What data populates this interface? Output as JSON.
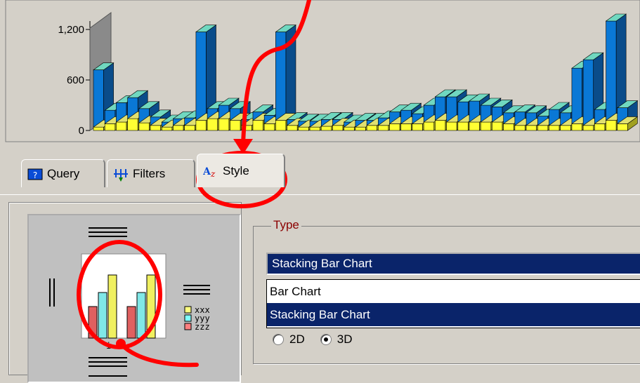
{
  "chart_data": {
    "type": "bar",
    "yticks": [
      "1,200",
      "600",
      "0"
    ],
    "ylim": [
      0,
      1300
    ],
    "stacked": true,
    "three_d": true,
    "series": [
      {
        "color": "#0a78d6",
        "values": [
          680,
          160,
          230,
          250,
          170,
          100,
          60,
          80,
          90,
          1050,
          120,
          160,
          140,
          70,
          100,
          100,
          1050,
          70,
          70,
          70,
          80,
          70,
          60,
          80,
          60,
          90,
          140,
          160,
          120,
          200,
          280,
          300,
          240,
          250,
          200,
          180,
          130,
          160,
          150,
          110,
          190,
          150,
          660,
          780,
          170,
          1180,
          190
        ]
      },
      {
        "color": "#ffff33",
        "values": [
          40,
          80,
          100,
          140,
          90,
          60,
          40,
          60,
          60,
          120,
          140,
          140,
          120,
          60,
          120,
          80,
          120,
          60,
          40,
          40,
          50,
          60,
          40,
          40,
          60,
          60,
          80,
          80,
          80,
          100,
          120,
          100,
          100,
          100,
          100,
          100,
          80,
          60,
          60,
          60,
          60,
          60,
          80,
          60,
          80,
          120,
          80
        ]
      }
    ]
  },
  "tabs": [
    {
      "label": "Query",
      "icon": "query-icon"
    },
    {
      "label": "Filters",
      "icon": "filters-icon"
    },
    {
      "label": "Style",
      "icon": "style-icon"
    }
  ],
  "type_group": {
    "legend": "Type",
    "selected": "Stacking Bar Chart",
    "options": [
      "Bar Chart",
      "Stacking Bar Chart"
    ],
    "radios": [
      {
        "label": "2D",
        "checked": false
      },
      {
        "label": "3D",
        "checked": true
      }
    ]
  },
  "preview": {
    "legend_items": [
      "xxx",
      "yyy",
      "zzz"
    ],
    "legend_colors": [
      "#ffff80",
      "#80ffff",
      "#ff8080"
    ],
    "axis_label": "i"
  },
  "annotation_color": "#ff0000"
}
